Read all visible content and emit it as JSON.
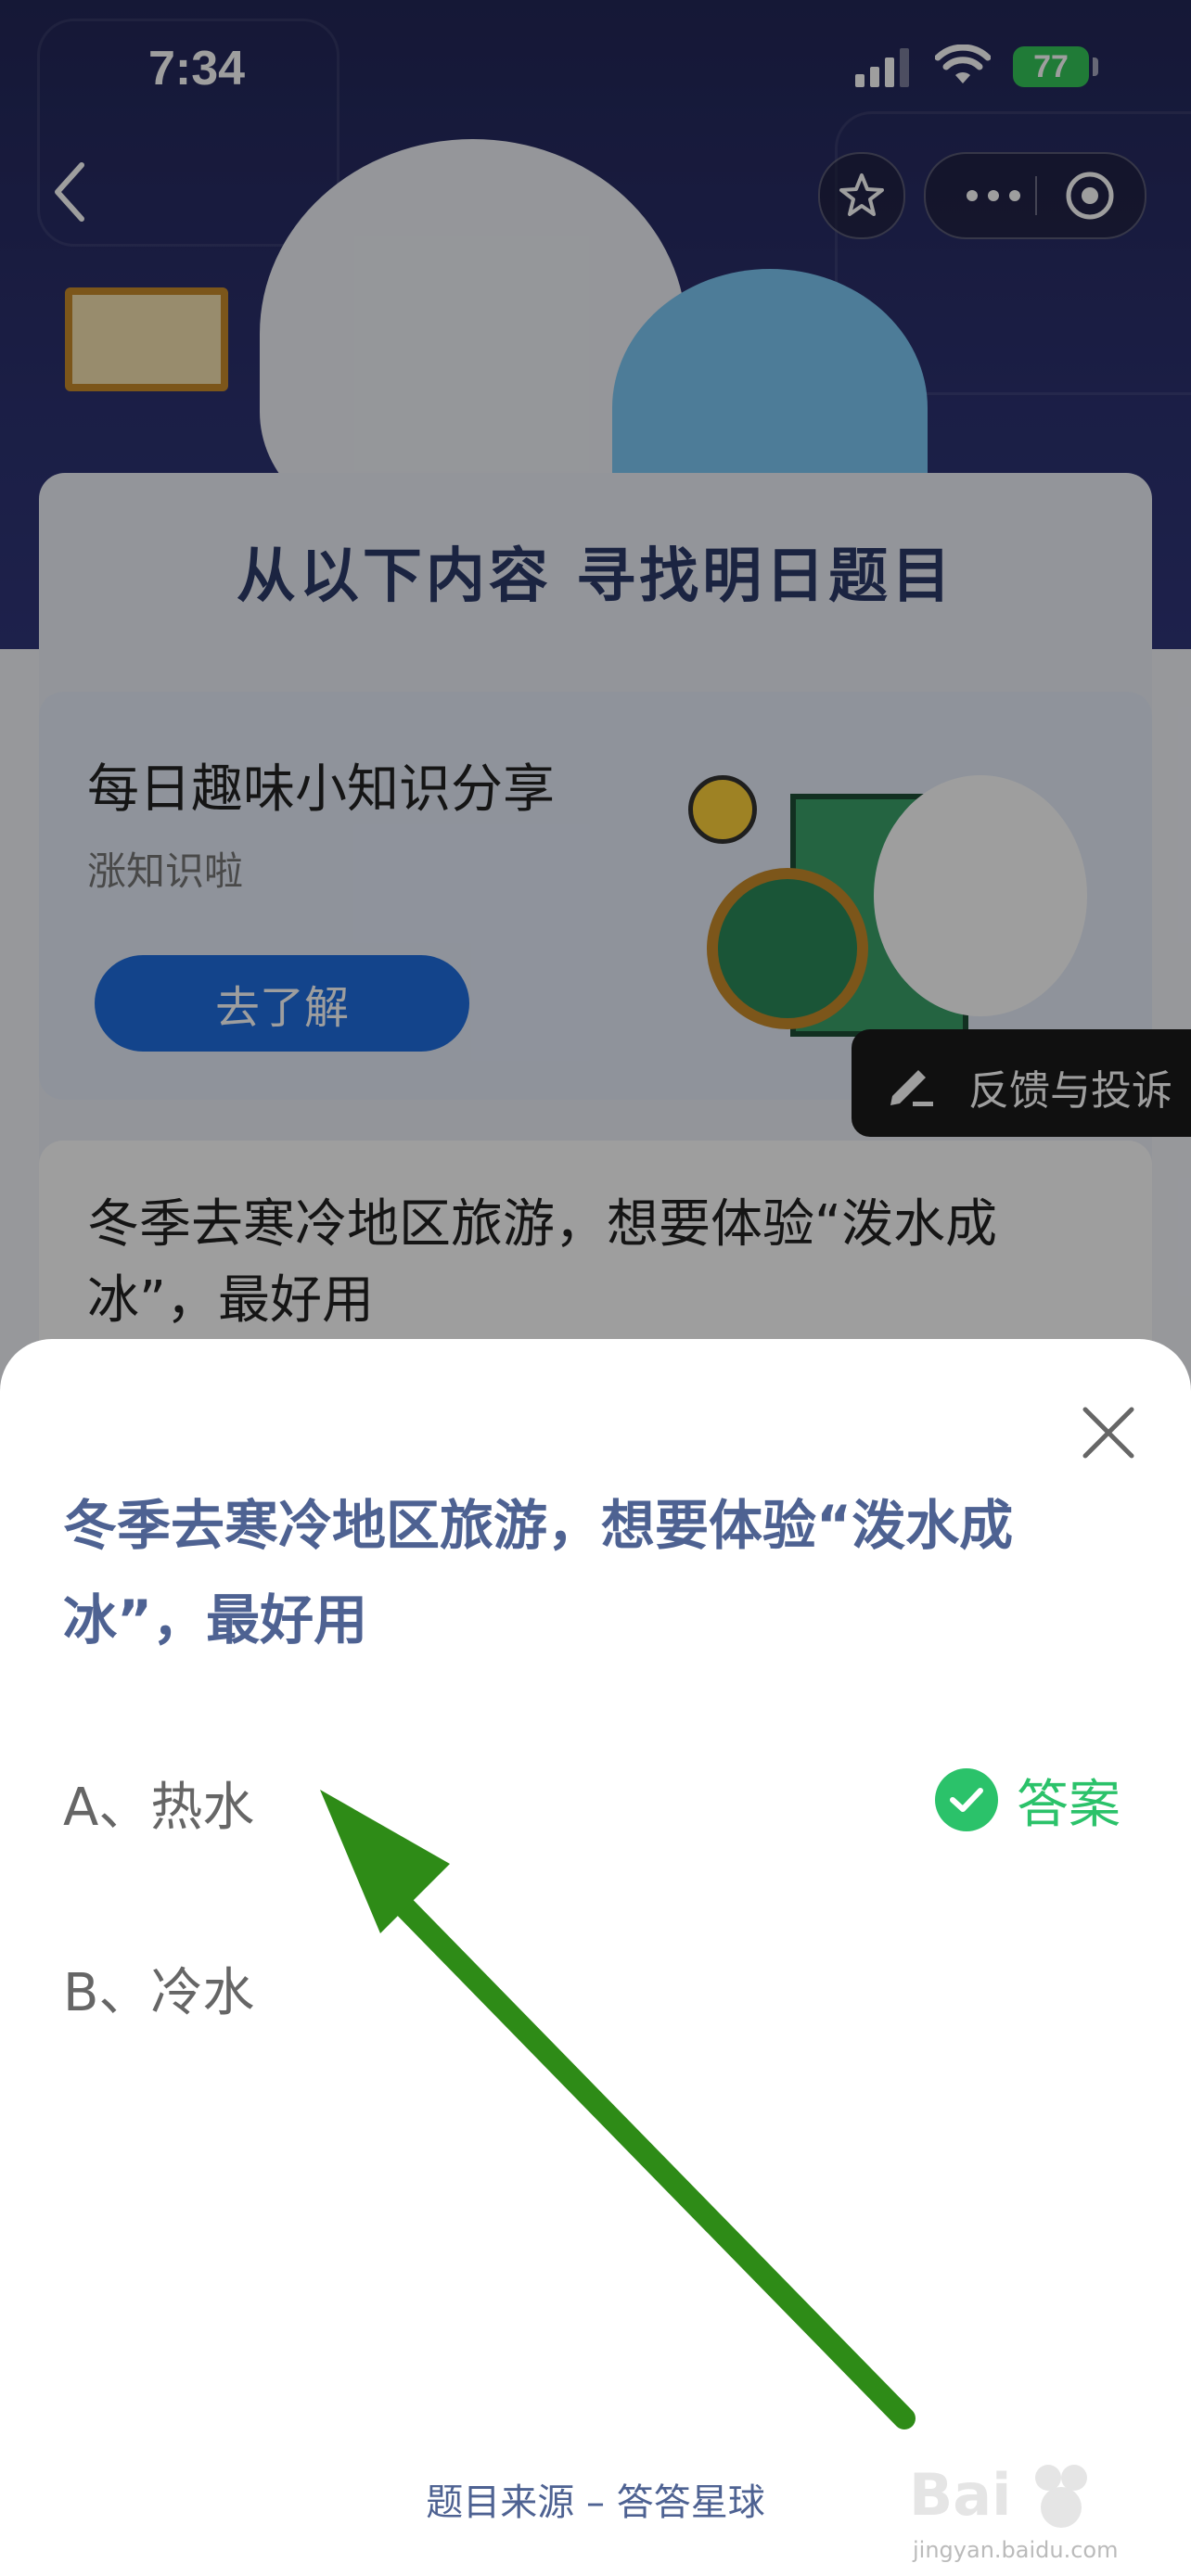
{
  "status_bar": {
    "time": "7:34",
    "battery": "77"
  },
  "hero": {
    "section_title": "从以下内容 寻找明日题目"
  },
  "card_knowledge": {
    "title": "每日趣味小知识分享",
    "subtitle": "涨知识啦",
    "button_label": "去了解"
  },
  "feedback": {
    "label": "反馈与投诉"
  },
  "card_question": {
    "text": "冬季去寒冷地区旅游，想要体验“泼水成冰”，最好用"
  },
  "sheet": {
    "question": "冬季去寒冷地区旅游，想要体验“泼水成冰”，最好用",
    "options": [
      {
        "label": "A、热水",
        "is_answer": true
      },
      {
        "label": "B、冷水",
        "is_answer": false
      }
    ],
    "answer_label": "答案",
    "source": "题目来源 – 答答星球"
  },
  "watermark": {
    "text": "jingyan.baidu.com"
  },
  "colors": {
    "accent_blue": "#4e6292",
    "answer_green": "#2bc26a",
    "arrow_green": "#2e8b17",
    "hero_bg": "#2c3170"
  }
}
